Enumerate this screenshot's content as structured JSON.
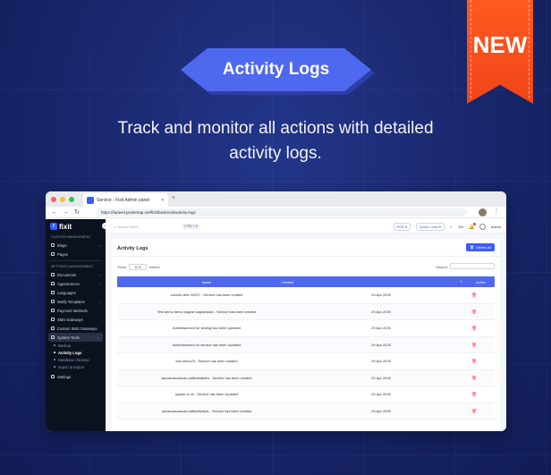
{
  "promo": {
    "title": "Activity Logs",
    "new_badge": "NEW",
    "subtitle": "Track and monitor all actions with detailed activity logs."
  },
  "browser": {
    "tab_title": "Service - Fixit Admin panel",
    "url": "https://laravel.pixelstrap.net/fixit/backend/activity-logs"
  },
  "sidebar": {
    "logo": "fixit",
    "sections": [
      {
        "label": "CUSTOM MANAGEMENT"
      },
      {
        "label": "SETTINGS MANAGEMENT"
      }
    ],
    "items_top": [
      {
        "label": "Blogs",
        "chevron": true
      },
      {
        "label": "Pages",
        "chevron": false
      }
    ],
    "items_settings": [
      {
        "label": "Documents",
        "chevron": true
      },
      {
        "label": "Appearances",
        "chevron": true
      },
      {
        "label": "Languages",
        "chevron": false
      },
      {
        "label": "Notify Templates",
        "chevron": true
      },
      {
        "label": "Payment Methods",
        "chevron": false
      },
      {
        "label": "SMS Gateways",
        "chevron": false
      },
      {
        "label": "Custom SMS Gateways",
        "chevron": false
      }
    ],
    "active_group": "System Tools",
    "sub_items": [
      "Backup",
      "Activity Logs",
      "Database Cleanup",
      "Import & Export"
    ],
    "current_sub": 1,
    "settings_label": "Settings"
  },
  "topbar": {
    "search_placeholder": "Search Here...",
    "shortcut": "CTRL + K",
    "pos_label": "POS",
    "quick_links_label": "Quick Links",
    "language": "EN",
    "user_name": "admin"
  },
  "card": {
    "title": "Activity Logs",
    "delete_all_label": "Delete All",
    "show_label": "Show",
    "entries_value": "10",
    "entries_label": "entries",
    "search_label": "Search:"
  },
  "table": {
    "headers": {
      "name": "Name",
      "created": "Created",
      "action": "Action"
    },
    "rows": [
      {
        "name": "custom offer 33027 - Service has been created",
        "date": "29-Apr-2025"
      },
      {
        "name": "Test demo demo sagear sagearsdsh - Service has been created",
        "date": "29-Apr-2025"
      },
      {
        "name": "Advertisement for testing has been Updated",
        "date": "29-Apr-2025"
      },
      {
        "name": "Advertisement for service has been Updated",
        "date": "29-Apr-2025"
      },
      {
        "name": "test demo23 - Service has been created",
        "date": "29-Apr-2025"
      },
      {
        "name": "ascascascascas calltesfsafsfvs - Service has been created",
        "date": "29-Apr-2025"
      },
      {
        "name": "update in ce - Service has been Updated",
        "date": "29-Apr-2025"
      },
      {
        "name": "ascascascascas callfsefsafsvs - Service has been created",
        "date": "29-Apr-2025"
      }
    ]
  },
  "colors": {
    "background": "#1a2a6e",
    "accent": "#4f68f0",
    "ribbon": "#f0451a",
    "sidebar": "#0c1120"
  }
}
